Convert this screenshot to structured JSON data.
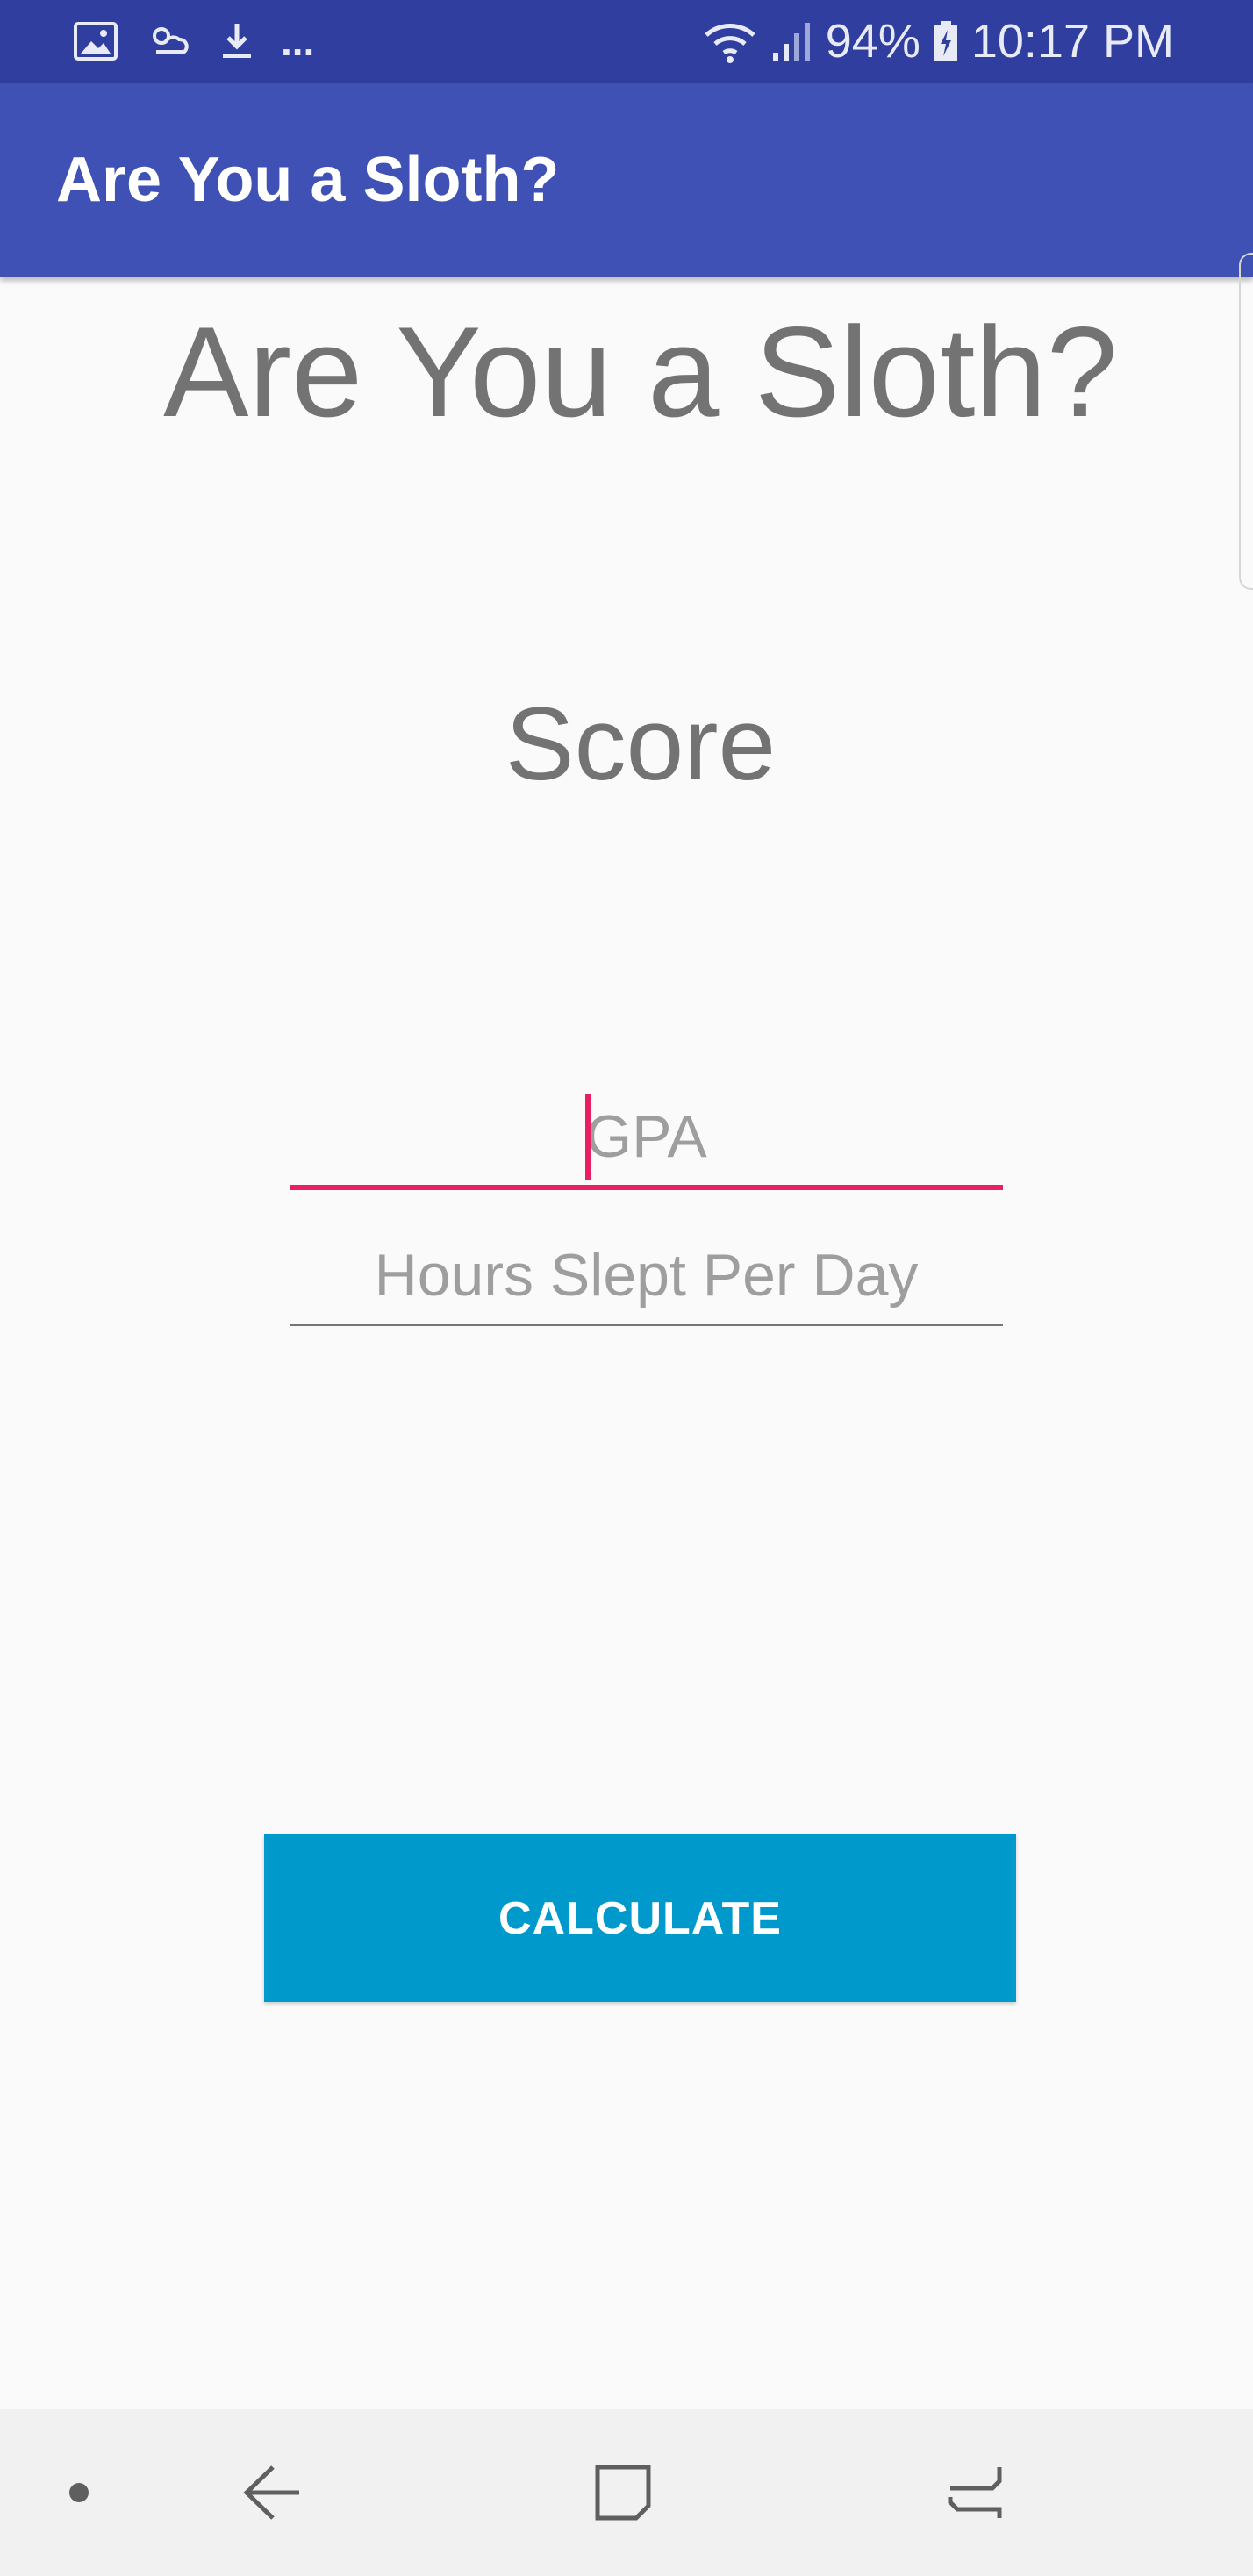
{
  "status_bar": {
    "battery": "94%",
    "time": "10:17 PM",
    "overflow": "...",
    "icons": [
      "gallery-icon",
      "weather-icon",
      "download-icon",
      "wifi-icon",
      "signal-icon",
      "battery-charging-icon"
    ]
  },
  "app_bar": {
    "title": "Are You a Sloth?"
  },
  "main": {
    "heading": "Are You a Sloth?",
    "score_label": "Score",
    "gpa_placeholder": "GPA",
    "hours_placeholder": "Hours Slept Per Day",
    "calculate_label": "CALCULATE"
  },
  "nav_bar": {
    "icons": [
      "dot-icon",
      "back-icon",
      "recents-icon",
      "recent-apps-icon"
    ]
  },
  "colors": {
    "status_bar": "#303f9f",
    "app_bar": "#3f51b5",
    "accent": "#e91e63",
    "button": "#0099cc",
    "background": "#fafafa"
  }
}
